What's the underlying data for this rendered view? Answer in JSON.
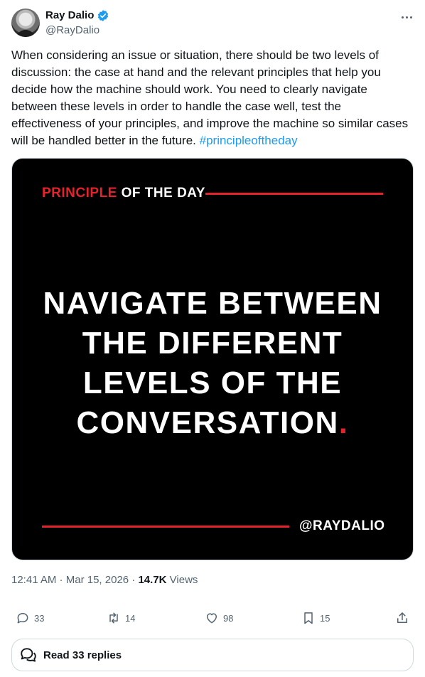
{
  "author": {
    "name": "Ray Dalio",
    "handle": "@RayDalio",
    "verified": true
  },
  "tweet": {
    "text": "When considering an issue or situation, there should be two levels of discussion: the case at hand and the relevant principles that help you decide how the machine should work. You need to clearly navigate between these levels in order to handle the case well, test the effectiveness of your principles, and improve the machine so similar cases will be handled better in the future.",
    "hashtag": "#principleoftheday"
  },
  "card": {
    "kicker_red": "PRINCIPLE",
    "kicker_white": "OF THE DAY",
    "headline_lines": [
      "NAVIGATE BETWEEN",
      "THE DIFFERENT",
      "LEVELS OF THE",
      "CONVERSATION"
    ],
    "headline_dot": ".",
    "signature": "@RAYDALIO",
    "accent_color": "#e4222b"
  },
  "meta": {
    "time": "12:41 AM",
    "date": "Mar 15, 2026",
    "views_count": "14.7K",
    "views_label": "Views"
  },
  "actions": {
    "replies": "33",
    "reposts": "14",
    "likes": "98",
    "bookmarks": "15"
  },
  "replies_button": {
    "label": "Read 33 replies"
  }
}
